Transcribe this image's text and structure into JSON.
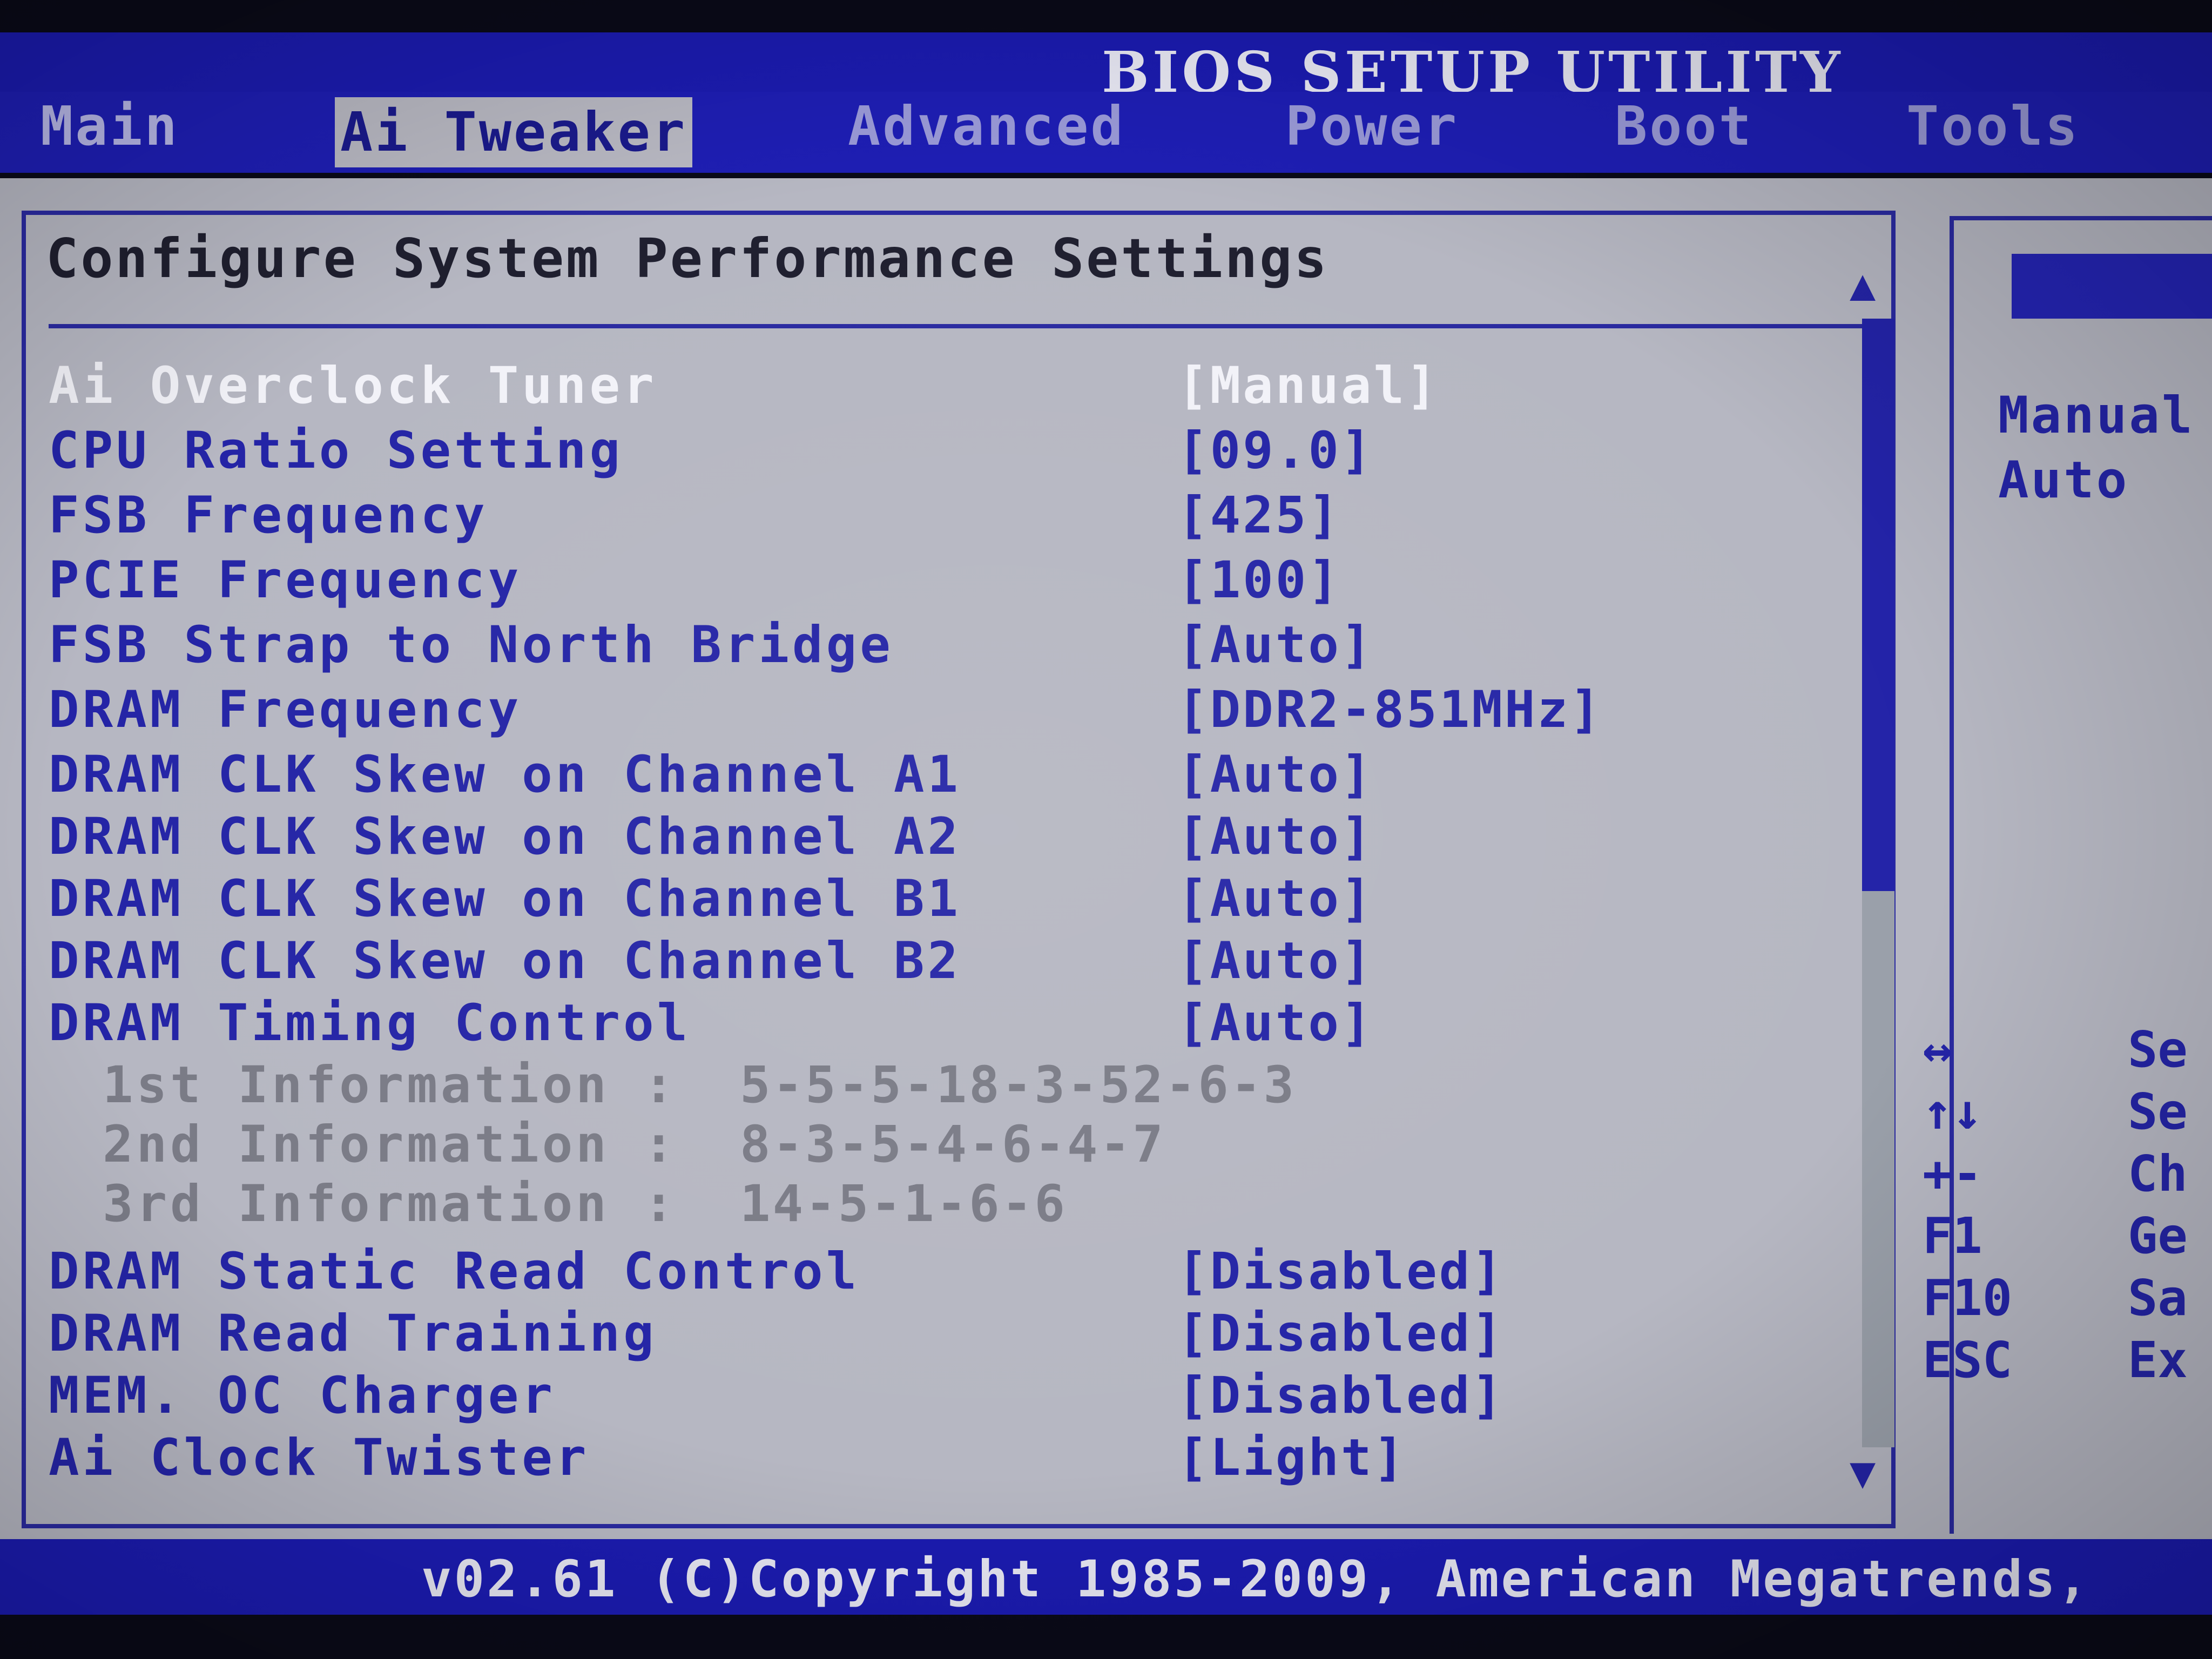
{
  "window": {
    "title": "BIOS SETUP UTILITY"
  },
  "tabs": [
    {
      "label": "Main"
    },
    {
      "label": "Ai Tweaker"
    },
    {
      "label": "Advanced"
    },
    {
      "label": "Power"
    },
    {
      "label": "Boot"
    },
    {
      "label": "Tools"
    }
  ],
  "section": {
    "title": "Configure System Performance Settings"
  },
  "settings": [
    {
      "label": "Ai Overclock Tuner",
      "value": "[Manual]"
    },
    {
      "label": "CPU Ratio Setting",
      "value": "[09.0]"
    },
    {
      "label": "FSB Frequency",
      "value": "[425]"
    },
    {
      "label": "PCIE Frequency",
      "value": "[100]"
    },
    {
      "label": "FSB Strap to North Bridge",
      "value": "[Auto]"
    },
    {
      "label": "DRAM Frequency",
      "value": "[DDR2-851MHz]"
    },
    {
      "label": "DRAM CLK Skew on Channel A1",
      "value": "[Auto]"
    },
    {
      "label": "DRAM CLK Skew on Channel A2",
      "value": "[Auto]"
    },
    {
      "label": "DRAM CLK Skew on Channel B1",
      "value": "[Auto]"
    },
    {
      "label": "DRAM CLK Skew on Channel B2",
      "value": "[Auto]"
    },
    {
      "label": "DRAM Timing Control",
      "value": "[Auto]"
    }
  ],
  "info": [
    {
      "label": "1st Information :",
      "value": "5-5-5-18-3-52-6-3"
    },
    {
      "label": "2nd Information :",
      "value": "8-3-5-4-6-4-7"
    },
    {
      "label": "3rd Information :",
      "value": "14-5-1-6-6"
    }
  ],
  "settings2": [
    {
      "label": "DRAM Static Read Control",
      "value": "[Disabled]"
    },
    {
      "label": "DRAM Read Training",
      "value": "[Disabled]"
    },
    {
      "label": "MEM. OC Charger",
      "value": "[Disabled]"
    },
    {
      "label": "Ai Clock Twister",
      "value": "[Light]"
    }
  ],
  "side": {
    "options": [
      "Manual",
      "Auto"
    ],
    "keys": [
      {
        "key": "↔",
        "desc": "Se"
      },
      {
        "key": "↑↓",
        "desc": "Se"
      },
      {
        "key": "+-",
        "desc": "Ch"
      },
      {
        "key": "F1",
        "desc": "Ge"
      },
      {
        "key": "F10",
        "desc": "Sa"
      },
      {
        "key": "ESC",
        "desc": "Ex"
      }
    ]
  },
  "scroll": {
    "up_arrow": "▲",
    "down_arrow": "▼"
  },
  "footer": {
    "text": "v02.61 (C)Copyright 1985-2009, American Megatrends,"
  },
  "colors": {
    "bar_blue": "#1b1bb0",
    "panel_gray": "#b6b7c2",
    "text_blue": "#2424a6",
    "selected_text": "#f2f2f8",
    "info_gray": "#7a7b86"
  }
}
